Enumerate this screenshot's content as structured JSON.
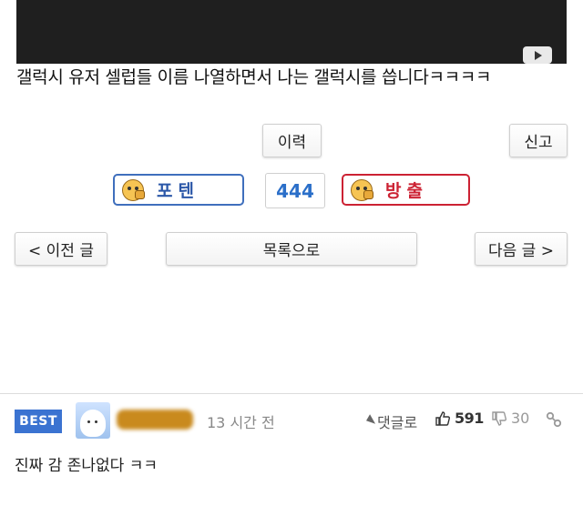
{
  "post": {
    "title": "갤럭시 유저 셀럽들 이름 나열하면서 나는 갤럭시를 씁니다ㅋㅋㅋㅋ"
  },
  "actions": {
    "history_label": "이력",
    "report_label": "신고",
    "vote_up_label": "포텐",
    "vote_down_label": "방출",
    "vote_count": "444",
    "prev_label": "< 이전 글",
    "list_label": "목록으로",
    "next_label": "다음 글 >"
  },
  "comment": {
    "badge": "BEST",
    "time": "13 시간 전",
    "reply_label": "댓글로",
    "likes": "591",
    "dislikes": "30",
    "text": "진짜 감 존나없다 ㅋㅋ"
  },
  "colors": {
    "accent_blue": "#3b73d1",
    "vote_up": "#3f6fbd",
    "vote_down": "#cc2233",
    "count_text": "#2b6fc9"
  },
  "icons": {
    "play": "play-icon",
    "vote_up_face": "thumbs-up-face-icon",
    "vote_down_face": "thumbs-down-face-icon",
    "reply": "reply-arrow-icon",
    "like": "thumbs-up-icon",
    "dislike": "thumbs-down-icon",
    "link": "link-icon"
  }
}
